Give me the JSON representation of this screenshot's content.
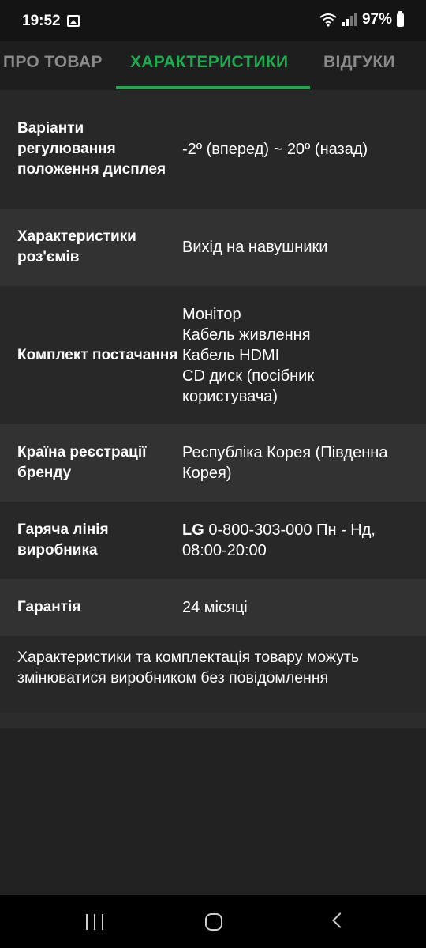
{
  "status_bar": {
    "time": "19:52",
    "battery": "97%",
    "icons": [
      "gallery-icon",
      "wifi-icon",
      "signal-icon",
      "battery-icon"
    ]
  },
  "tabs": [
    {
      "label": "ПРО ТОВАР",
      "active": false
    },
    {
      "label": "ХАРАКТЕРИСТИКИ",
      "active": true
    },
    {
      "label": "ВІДГУКИ",
      "active": false
    }
  ],
  "specs": [
    {
      "label": "Варіанти регулювання положення дисплея",
      "value": "-2º (вперед) ~ 20º (назад)"
    },
    {
      "label": "Характеристики роз'ємів",
      "value": "Вихід на навушники"
    },
    {
      "label": "Комплект постачання",
      "value": "Монітор\nКабель живлення\nКабель HDMI\nCD диск (посібник користувача)"
    },
    {
      "label": "Країна реєстрації бренду",
      "value": "Республіка Корея (Південна Корея)"
    },
    {
      "label": "Гаряча лінія виробника",
      "value_brand": "LG",
      "value": " 0-800-303-000 Пн - Нд, 08:00-20:00"
    },
    {
      "label": "Гарантія",
      "value": "24 місяці"
    }
  ],
  "note": "Характеристики та комплектація товару можуть змінюватися виробником без повідомлення",
  "nav_bar": {
    "icons": [
      "recents-icon",
      "home-icon",
      "back-icon"
    ]
  },
  "colors": {
    "accent": "#1faa4e",
    "background": "#222222",
    "row_dark": "#282828",
    "row_light": "#323232"
  }
}
